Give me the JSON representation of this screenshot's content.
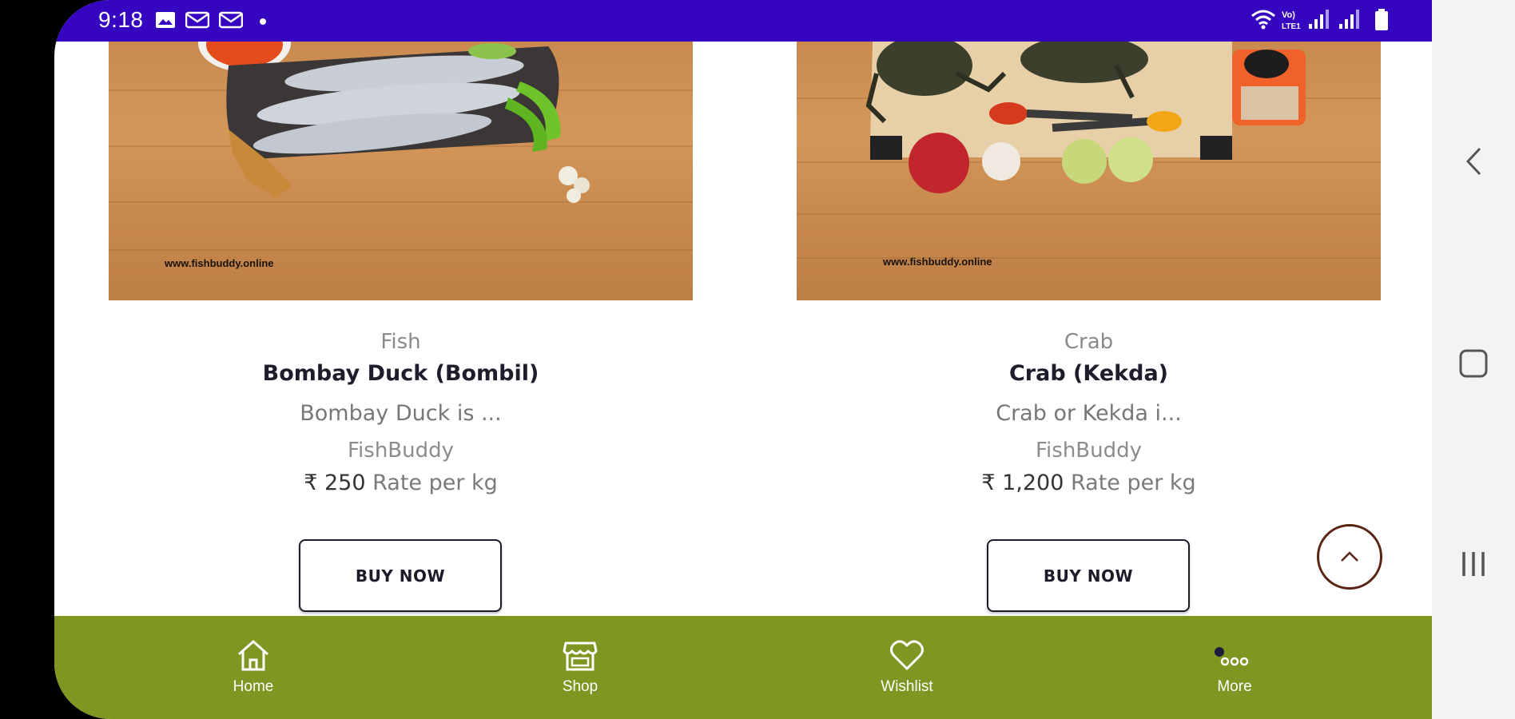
{
  "status_bar": {
    "time": "9:18",
    "background": "#3505c0",
    "left_icons": [
      "image-icon",
      "mail-icon",
      "mail-icon",
      "dot-icon"
    ],
    "right_icons": [
      "wifi-icon",
      "volte-icon",
      "signal-icon",
      "signal-icon",
      "battery-icon"
    ],
    "volte_text": "Vo)\nLTE1"
  },
  "products": [
    {
      "category": "Fish",
      "name": "Bombay Duck (Bombil)",
      "description": "Bombay Duck is ...",
      "seller": "FishBuddy",
      "currency": "₹",
      "price": "250",
      "unit": "Rate per kg",
      "button": "BUY NOW",
      "watermark": "www.fishbuddy.online"
    },
    {
      "category": "Crab",
      "name": "Crab (Kekda)",
      "description": "Crab or Kekda i...",
      "seller": "FishBuddy",
      "currency": "₹",
      "price": "1,200",
      "unit": "Rate per kg",
      "button": "BUY NOW",
      "watermark": "www.fishbuddy.online"
    }
  ],
  "bottom_nav": {
    "background": "#7f9722",
    "items": [
      {
        "label": "Home",
        "icon": "home-icon"
      },
      {
        "label": "Shop",
        "icon": "shop-icon"
      },
      {
        "label": "Wishlist",
        "icon": "heart-icon"
      },
      {
        "label": "More",
        "icon": "more-icon"
      }
    ]
  },
  "system_nav": [
    "back-icon",
    "home-square-icon",
    "recents-icon"
  ]
}
